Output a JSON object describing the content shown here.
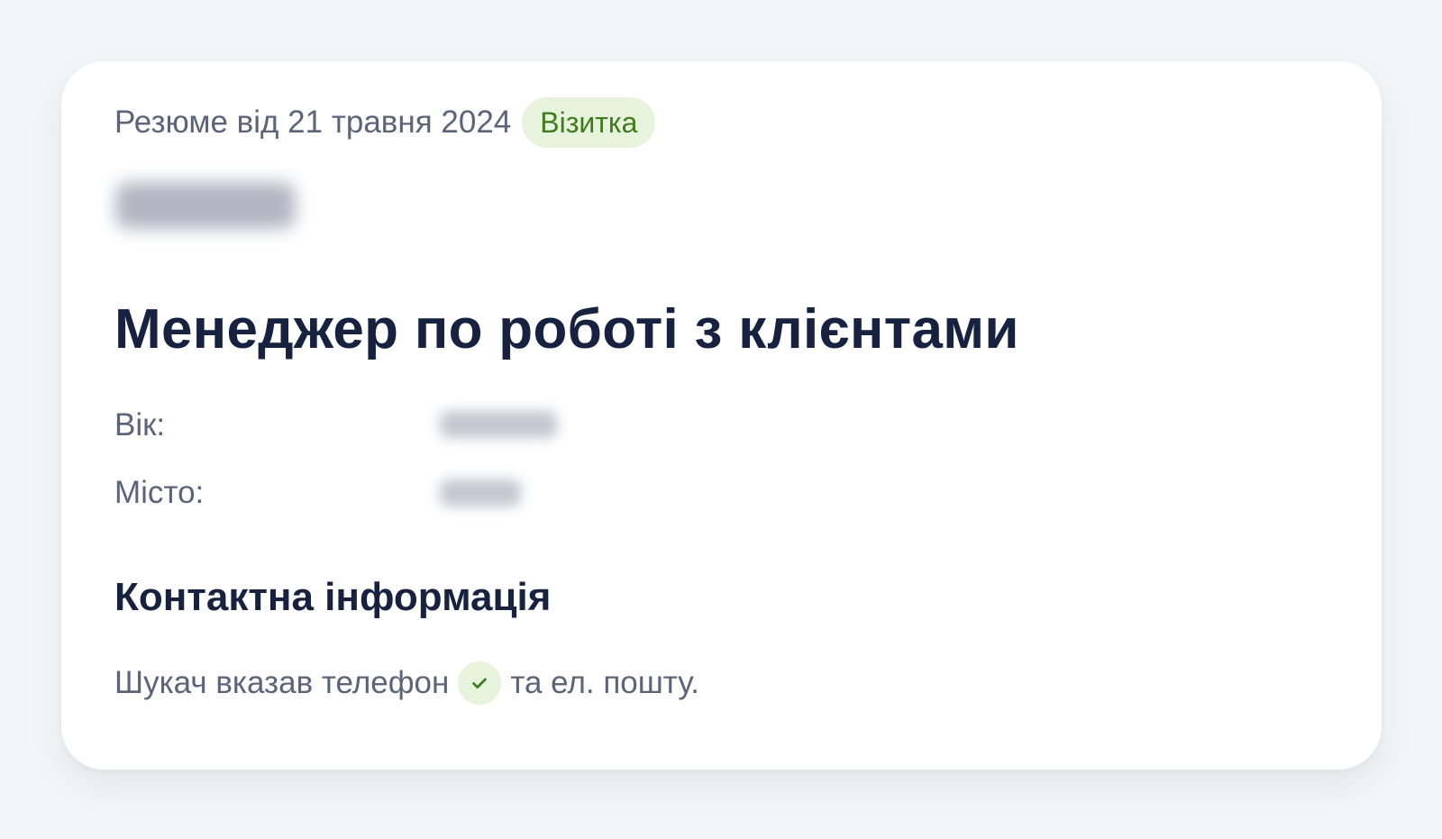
{
  "resume": {
    "date_text": "Резюме від 21 травня 2024",
    "badge": "Візитка",
    "title": "Менеджер по роботі з клієнтами",
    "age_label": "Вік:",
    "city_label": "Місто:"
  },
  "contact": {
    "heading": "Контактна інформація",
    "before_icon": "Шукач вказав телефон",
    "after_icon": "та ел. пошту."
  },
  "colors": {
    "badge_bg": "#e7f3dc",
    "badge_text": "#3e7d1d",
    "heading": "#162240",
    "muted_text": "#5b6478"
  },
  "icons": {
    "check": "check-icon"
  }
}
